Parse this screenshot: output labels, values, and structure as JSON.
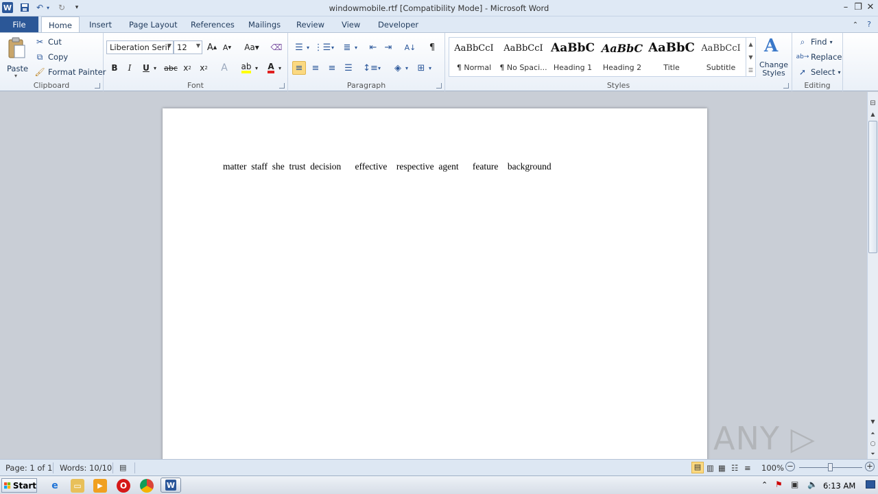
{
  "window": {
    "title": "windowmobile.rtf [Compatibility Mode]  -  Microsoft Word"
  },
  "tabs": [
    "File",
    "Home",
    "Insert",
    "Page Layout",
    "References",
    "Mailings",
    "Review",
    "View",
    "Developer"
  ],
  "clipboard": {
    "paste": "Paste",
    "cut": "Cut",
    "copy": "Copy",
    "format_painter": "Format Painter",
    "label": "Clipboard"
  },
  "font": {
    "name": "Liberation Serif",
    "size": "12",
    "label": "Font"
  },
  "paragraph": {
    "label": "Paragraph"
  },
  "styles": {
    "label": "Styles",
    "items": [
      {
        "sample": "AaBbCcI",
        "name": "¶ Normal"
      },
      {
        "sample": "AaBbCcI",
        "name": "¶ No Spaci..."
      },
      {
        "sample": "AaBbC",
        "name": "Heading 1"
      },
      {
        "sample": "AaBbC",
        "name": "Heading 2"
      },
      {
        "sample": "AaBbC",
        "name": "Title"
      },
      {
        "sample": "AaBbCcI",
        "name": "Subtitle"
      }
    ],
    "change_styles": "Change Styles"
  },
  "editing": {
    "find": "Find",
    "replace": "Replace",
    "select": "Select",
    "label": "Editing"
  },
  "document": {
    "text": "matter  staff  she  trust  decision      effective    respective  agent      feature    background"
  },
  "statusbar": {
    "page": "Page: 1 of 1",
    "words": "Words: 10/10",
    "zoom": "100%"
  },
  "taskbar": {
    "start": "Start",
    "clock": "6:13 AM"
  },
  "watermark": "ANY ▷ RUN"
}
